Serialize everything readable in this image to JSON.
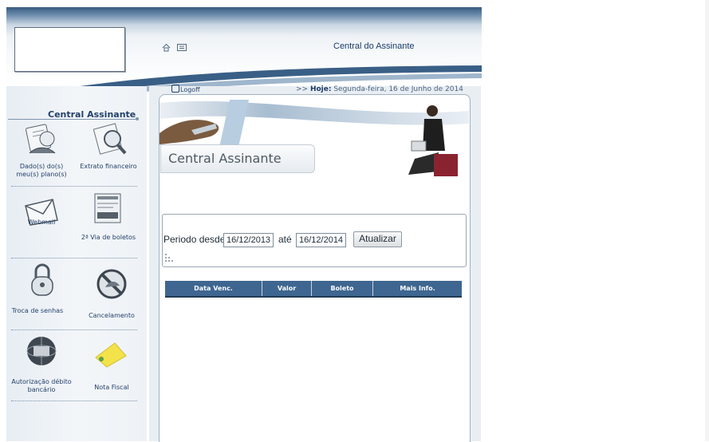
{
  "header": {
    "central_link": "Central do Assinante"
  },
  "topbar": {
    "logoff": "Logoff",
    "date_prefix": ">> ",
    "date_label": "Hoje:",
    "date_value": " Segunda-feira, 16 de Junho de 2014"
  },
  "sidebar": {
    "title": "Central Assinante",
    "items": [
      {
        "label": "Dado(s) do(s) meu(s) plano(s)",
        "icon": "person-document-icon"
      },
      {
        "label": "Extrato financeiro",
        "icon": "magnifier-icon"
      },
      {
        "label": "Webmail",
        "icon": "envelope-icon"
      },
      {
        "label": "2ª Via de boletos",
        "icon": "boleto-icon"
      },
      {
        "label": "Troca de senhas",
        "icon": "padlock-icon"
      },
      {
        "label": "Cancelamento",
        "icon": "cancel-icon"
      },
      {
        "label": "Autorização débito bancário",
        "icon": "bank-globe-icon"
      },
      {
        "label": "Nota Fiscal",
        "icon": "sticky-note-icon"
      }
    ]
  },
  "banner": {
    "title": "Central Assinante"
  },
  "filter": {
    "periodo_label": "Periodo desde",
    "from_value": "16/12/2013",
    "ate_label": "até",
    "to_value": "16/12/2014",
    "update_button": "Atualizar"
  },
  "table": {
    "columns": [
      "Data Venc.",
      "Valor",
      "Boleto",
      "Mais Info."
    ]
  },
  "colors": {
    "accent": "#3e6690",
    "header_dark": "#375a7e",
    "text_dark_blue": "#24406a"
  }
}
